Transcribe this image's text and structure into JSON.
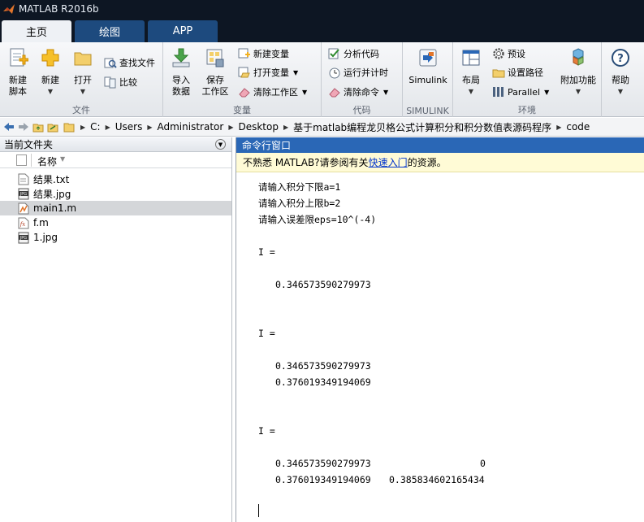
{
  "window": {
    "title": "MATLAB R2016b"
  },
  "tabs": [
    {
      "label": "主页",
      "active": true
    },
    {
      "label": "绘图",
      "active": false
    },
    {
      "label": "APP",
      "active": false
    }
  ],
  "ribbon": {
    "groups": {
      "file": "文件",
      "variable": "变量",
      "code": "代码",
      "simulink": "SIMULINK",
      "environment": "环境"
    },
    "new_script": [
      "新建",
      "脚本"
    ],
    "new": "新建",
    "open": "打开",
    "find_files": "查找文件",
    "compare": "比较",
    "import_data": [
      "导入",
      "数据"
    ],
    "save_workspace": [
      "保存",
      "工作区"
    ],
    "new_variable": "新建变量",
    "open_variable": "打开变量",
    "clear_workspace": "清除工作区",
    "analyze_code": "分析代码",
    "run_and_time": "运行并计时",
    "clear_commands": "清除命令",
    "simulink": "Simulink",
    "layout": "布局",
    "preferences": "预设",
    "set_path": "设置路径",
    "parallel": "Parallel",
    "addons": "附加功能",
    "help": "帮助"
  },
  "address": {
    "crumbs": [
      "C:",
      "Users",
      "Administrator",
      "Desktop",
      "基于matlab编程龙贝格公式计算积分和积分数值表源码程序",
      "code"
    ]
  },
  "file_panel": {
    "title": "当前文件夹",
    "column_name": "名称",
    "files": [
      {
        "name": "结果.txt",
        "icon": "text-file-icon",
        "selected": false
      },
      {
        "name": "结果.jpg",
        "icon": "jpg-file-icon",
        "selected": false
      },
      {
        "name": "main1.m",
        "icon": "m-file-icon",
        "selected": true
      },
      {
        "name": "f.m",
        "icon": "function-file-icon",
        "selected": false
      },
      {
        "name": "1.jpg",
        "icon": "jpg-file-icon",
        "selected": false
      }
    ]
  },
  "command_window": {
    "title": "命令行窗口",
    "info_prefix": "不熟悉 MATLAB?请参阅有关",
    "info_link": "快速入门",
    "info_suffix": "的资源。",
    "lines": [
      "请输入积分下限a=1",
      "请输入积分上限b=2",
      "请输入误差限eps=10^(-4)",
      "I =",
      "0.346573590279973",
      "I =",
      "0.346573590279973",
      "0.376019349194069",
      "I =",
      "0.346573590279973",
      "0",
      "0.376019349194069",
      "0.385834602165434"
    ]
  },
  "colors": {
    "title_bar": "#0d1623",
    "tab_inactive": "#1d4a7e",
    "command_header": "#2a67b6",
    "info_bar": "#fffbd6",
    "link": "#0033cc"
  }
}
